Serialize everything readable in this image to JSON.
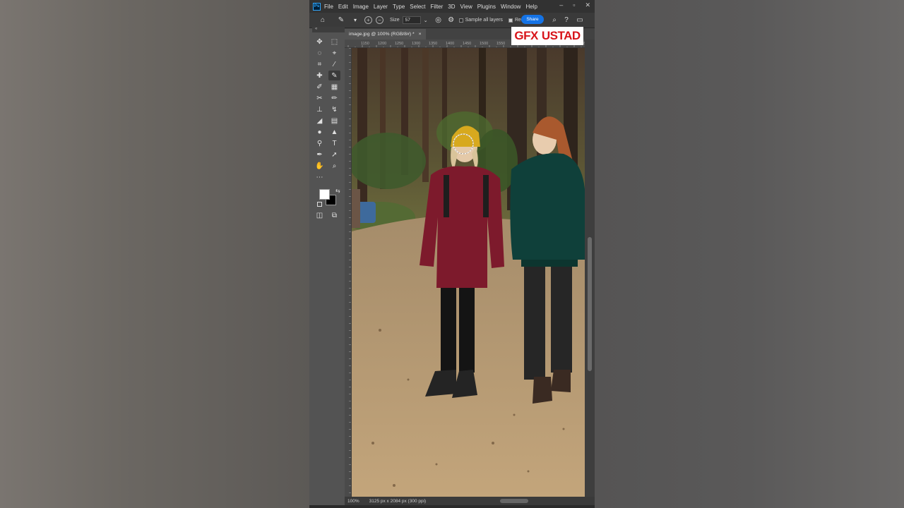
{
  "menubar": {
    "logo": "Ps",
    "items": [
      "File",
      "Edit",
      "Image",
      "Layer",
      "Type",
      "Select",
      "Filter",
      "3D",
      "View",
      "Plugins",
      "Window",
      "Help"
    ]
  },
  "options": {
    "size_label": "Size",
    "size_value": "57",
    "sample_all_layers": "Sample all layers",
    "remove_label": "Remo",
    "share": "Share"
  },
  "watermark": {
    "gfx": "GFX",
    "ustad": "USTAD"
  },
  "document": {
    "tab_title": "image.jpg @ 100% (RGB/8#) *",
    "close": "×"
  },
  "ruler": {
    "ticks": [
      "1150",
      "1200",
      "1250",
      "1300",
      "1350",
      "1400",
      "1450",
      "1500",
      "1550",
      "1600",
      "1650",
      "1700",
      "1750",
      "1800"
    ]
  },
  "status": {
    "zoom": "100%",
    "dimensions": "3125 px x 2084 px (300 ppi)"
  },
  "colors": {
    "accent": "#1473e6",
    "panel": "#535353",
    "menubar": "#323232",
    "foreground": "#ffffff",
    "background": "#000000"
  }
}
